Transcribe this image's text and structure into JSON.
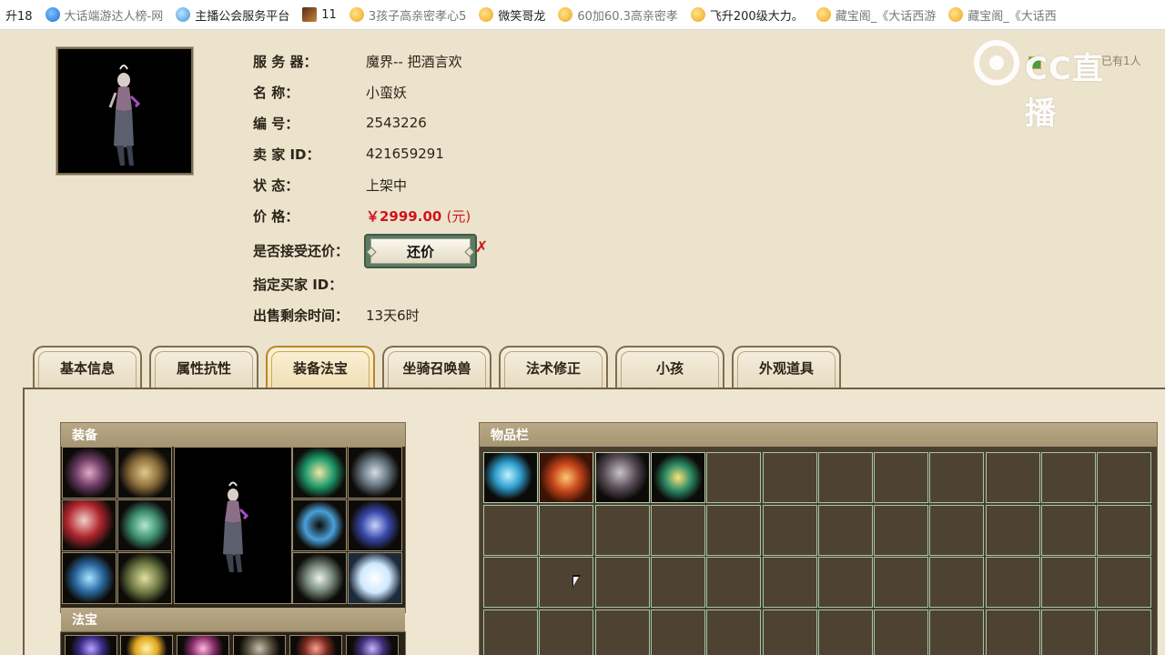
{
  "bookmarks": [
    {
      "label": "升18",
      "icon": "none"
    },
    {
      "label": "大话端游达人榜-网",
      "icon": "blue-globe-icon"
    },
    {
      "label": "主播公会服务平台",
      "icon": "cloud-icon"
    },
    {
      "label": "11",
      "icon": "game-icon"
    },
    {
      "label": "3孩子高亲密孝心5",
      "icon": "smile-icon"
    },
    {
      "label": "微笑哥龙",
      "icon": "smile-icon"
    },
    {
      "label": "60加60.3高亲密孝",
      "icon": "smile-icon"
    },
    {
      "label": "飞升200级大力。",
      "icon": "smile-icon"
    },
    {
      "label": "藏宝阁_《大话西游",
      "icon": "smile-icon"
    },
    {
      "label": "藏宝阁_《大话西",
      "icon": "smile-icon"
    }
  ],
  "character": {
    "server_label": "服 务 器：",
    "server_value": "魔界-- 把酒言欢",
    "name_label": "名          称：",
    "name_value": "小蛮妖",
    "id_label": "编          号：",
    "id_value": "2543226",
    "seller_label": "卖    家    ID：",
    "seller_value": "421659291",
    "status_label": "状          态：",
    "status_value": "上架中",
    "price_label": "价          格：",
    "price_value": "￥2999.00",
    "price_unit": "(元)",
    "bargain_label": "是否接受还价：",
    "bargain_button": "还价",
    "bargain_mark": "✗",
    "buyer_label": "指定买家 ID：",
    "buyer_value": "",
    "time_label": "出售剩余时间：",
    "time_value": "13天6时"
  },
  "watermark": {
    "brand": "CC直播",
    "hint": "已有1人"
  },
  "tabs": [
    {
      "label": "基本信息",
      "active": false
    },
    {
      "label": "属性抗性",
      "active": false
    },
    {
      "label": "装备法宝",
      "active": true
    },
    {
      "label": "坐骑召唤兽",
      "active": false
    },
    {
      "label": "法术修正",
      "active": false
    },
    {
      "label": "小孩",
      "active": false
    },
    {
      "label": "外观道具",
      "active": false
    }
  ],
  "equipment": {
    "title": "装备",
    "slots": [
      "jellyfish-armor-icon",
      "golden-hat-icon",
      "red-sword-icon",
      "jade-pants-icon",
      "blue-gauntlet-icon",
      "gold-boots-icon",
      "green-mask-icon",
      "silver-necklace-icon",
      "sapphire-ring-icon",
      "dark-orb-icon",
      "pearl-bracelet-icon",
      "white-orb-icon"
    ]
  },
  "fabao": {
    "title": "法宝"
  },
  "inventory": {
    "title": "物品栏",
    "items": [
      "blue-chain-icon",
      "fire-cloak-icon",
      "grey-fan-icon",
      "green-turtle-icon"
    ],
    "columns": 12,
    "rows": 4
  }
}
